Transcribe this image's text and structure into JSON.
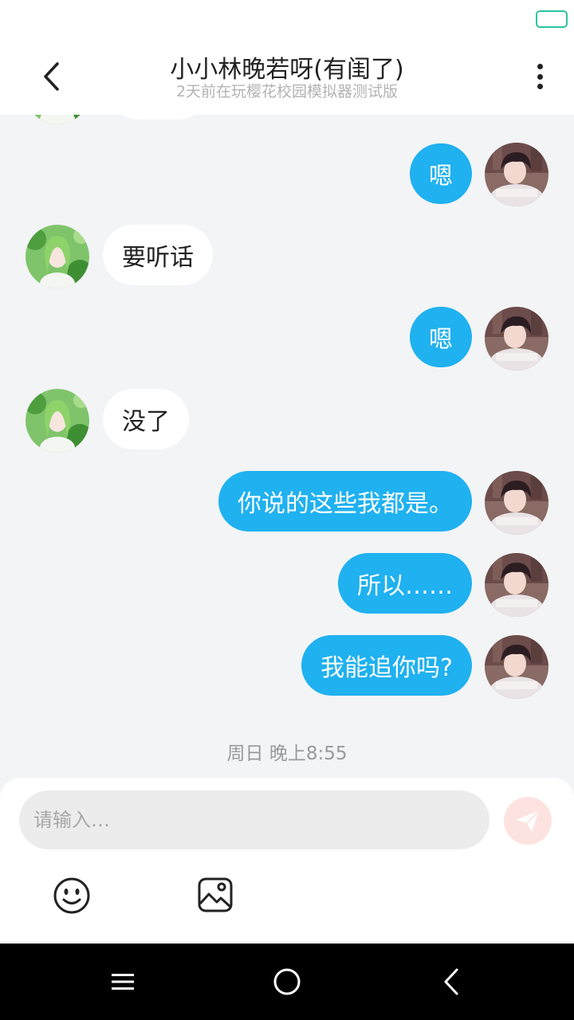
{
  "header": {
    "title": "小小林晚若呀(有闺了)",
    "subtitle": "2天前在玩樱花校园模拟器测试版"
  },
  "messages": [
    {
      "sender": "me",
      "text": "嗯"
    },
    {
      "sender": "her",
      "text": "要听话"
    },
    {
      "sender": "me",
      "text": "嗯"
    },
    {
      "sender": "her",
      "text": "没了"
    },
    {
      "sender": "me",
      "text": "你说的这些我都是。"
    },
    {
      "sender": "me",
      "text": "所以……"
    },
    {
      "sender": "me",
      "text": "我能追你吗?"
    }
  ],
  "timestamp": "周日 晚上8:55",
  "composer": {
    "placeholder": "请输入…"
  },
  "colors": {
    "my_bubble": "#1fb1f0",
    "her_bubble": "#ffffff",
    "chat_background": "#f3f4f6",
    "send_button": "#fde3df",
    "battery_outline": "#2bc4a0"
  },
  "icons": {
    "back": "chevron-left-icon",
    "more": "more-vertical-icon",
    "send": "paper-plane-icon",
    "emoji": "smiley-icon",
    "image": "image-icon",
    "nav_menu": "menu-icon",
    "nav_home": "home-circle-icon",
    "nav_back": "back-icon"
  }
}
